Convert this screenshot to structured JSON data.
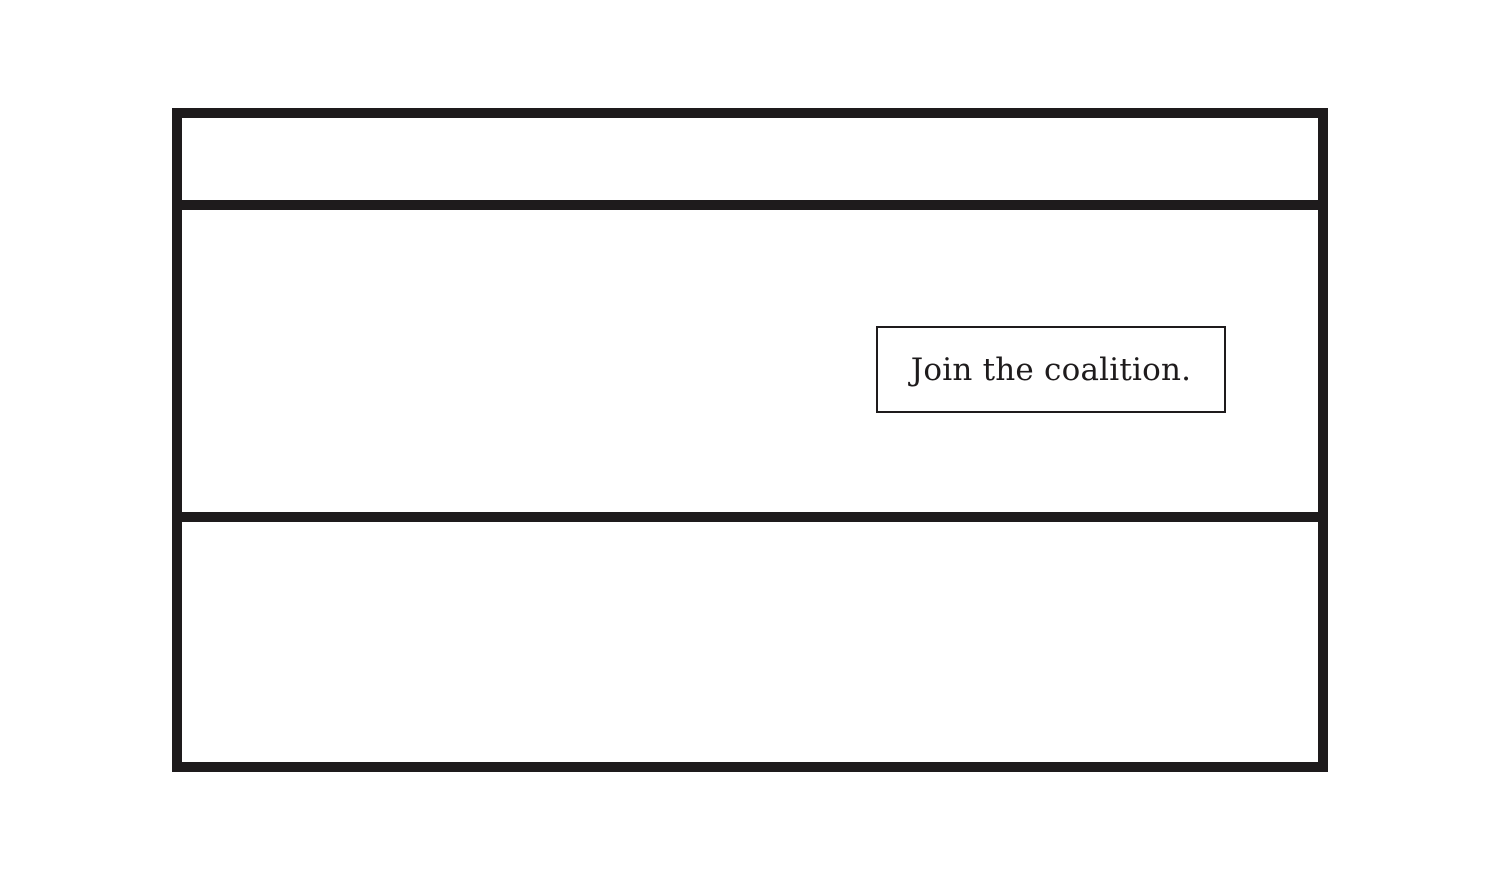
{
  "colors": {
    "stroke": "#1e1b1c",
    "background": "#ffffff"
  },
  "cta": {
    "label": "Join the coalition."
  }
}
